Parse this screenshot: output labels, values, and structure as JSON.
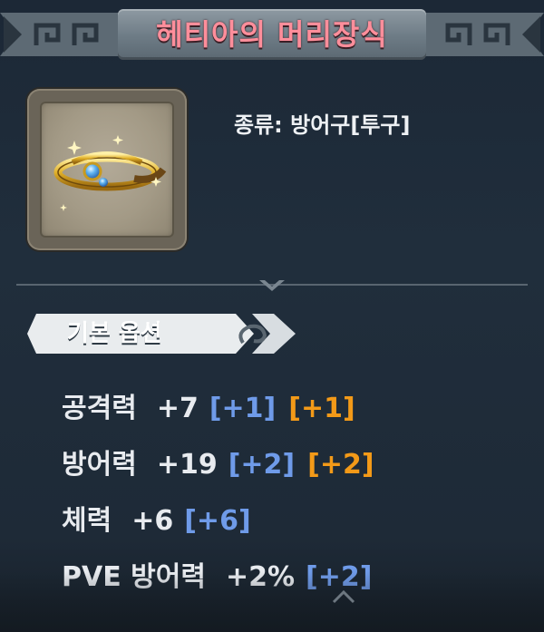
{
  "item": {
    "title": "헤티아의 머리장식",
    "type": "종류: 방어구[투구]",
    "icon": "golden-tiara-icon"
  },
  "section": {
    "label": "기본 옵션"
  },
  "stats": [
    {
      "name": "공격력",
      "value": "+7",
      "bonus_blue": "[+1]",
      "bonus_orange": "[+1]"
    },
    {
      "name": "방어력",
      "value": "+19",
      "bonus_blue": "[+2]",
      "bonus_orange": "[+2]"
    },
    {
      "name": "체력",
      "value": "+6",
      "bonus_blue": "[+6]"
    },
    {
      "name": "PVE 방어력",
      "value": "+2%",
      "bonus_blue": "[+2]"
    }
  ],
  "colors": {
    "title": "#ff8e9b",
    "bonus_blue": "#6f9be9",
    "bonus_orange": "#f39a18",
    "background": "#1f2c39"
  }
}
